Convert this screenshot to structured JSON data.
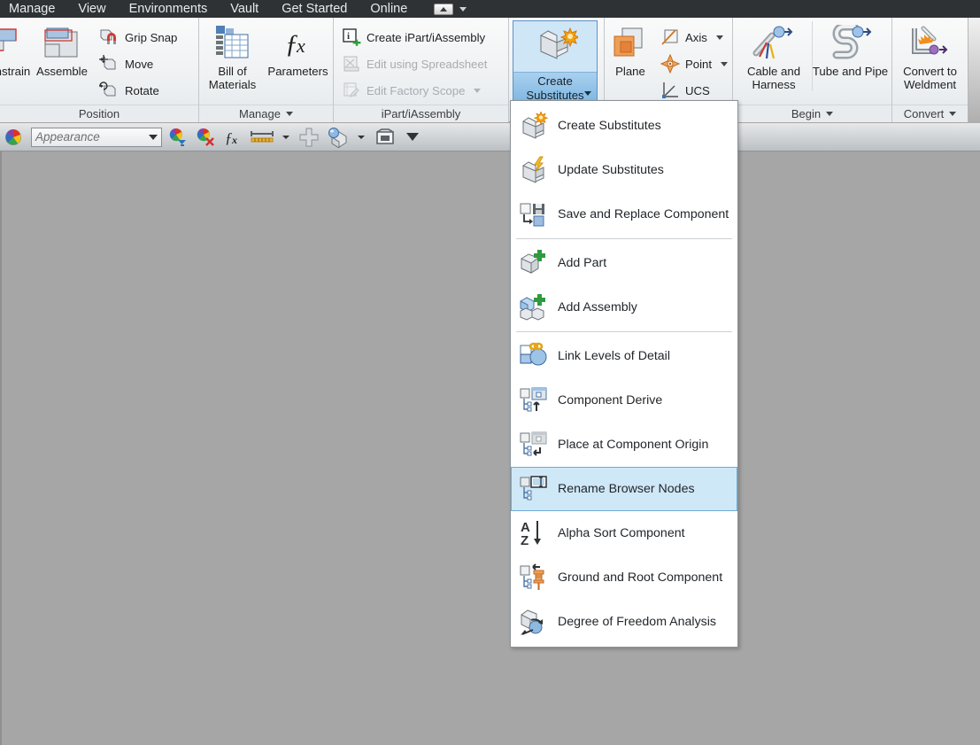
{
  "menubar": {
    "items": [
      "Manage",
      "View",
      "Environments",
      "Vault",
      "Get Started",
      "Online"
    ],
    "quick_access_icon": "minimize-ribbon-icon",
    "caret_icon": "chevron-down-icon"
  },
  "ribbon": {
    "panels": [
      {
        "title": "Position",
        "title_caret": false,
        "big_buttons": [
          {
            "label": "Constrain",
            "icon": "constrain-icon"
          },
          {
            "label": "Assemble",
            "icon": "assemble-icon"
          }
        ],
        "small_buttons": [
          {
            "label": "Grip Snap",
            "icon": "grip-snap-icon",
            "disabled": false,
            "caret": false
          },
          {
            "label": "Move",
            "icon": "move-component-icon",
            "disabled": false,
            "caret": false
          },
          {
            "label": "Rotate",
            "icon": "rotate-component-icon",
            "disabled": false,
            "caret": false
          }
        ]
      },
      {
        "title": "Manage",
        "title_caret": true,
        "big_buttons": [
          {
            "label": "Bill of Materials",
            "icon": "bill-of-materials-icon"
          },
          {
            "label": "Parameters",
            "icon": "parameters-fx-icon"
          }
        ],
        "small_buttons": []
      },
      {
        "title": "iPart/iAssembly",
        "title_caret": false,
        "big_buttons": [],
        "small_buttons": [
          {
            "label": "Create iPart/iAssembly",
            "icon": "create-ipart-icon",
            "disabled": false,
            "caret": false
          },
          {
            "label": "Edit using Spreadsheet",
            "icon": "edit-spreadsheet-icon",
            "disabled": true,
            "caret": false
          },
          {
            "label": "Edit Factory Scope",
            "icon": "edit-factory-scope-icon",
            "disabled": true,
            "caret": true
          }
        ]
      },
      {
        "title": "",
        "title_caret": false,
        "split_button": {
          "line1": "Create",
          "line2": "Substitutes",
          "icon": "create-substitutes-icon",
          "active": true,
          "caret_icon": "chevron-down-icon"
        }
      },
      {
        "title": "",
        "title_caret": false,
        "big_buttons": [
          {
            "label": "Plane",
            "icon": "work-plane-icon",
            "caret": true
          }
        ],
        "small_buttons": [
          {
            "label": "Axis",
            "icon": "work-axis-icon",
            "disabled": false,
            "caret": true
          },
          {
            "label": "Point",
            "icon": "work-point-icon",
            "disabled": false,
            "caret": true
          },
          {
            "label": "UCS",
            "icon": "ucs-icon",
            "disabled": false,
            "caret": false
          }
        ]
      },
      {
        "title": "Begin",
        "title_caret": true,
        "big_buttons": [
          {
            "label": "Cable and Harness",
            "icon": "cable-harness-icon"
          },
          {
            "label": "Tube and Pipe",
            "icon": "tube-pipe-icon"
          }
        ],
        "small_buttons": []
      },
      {
        "title": "Convert",
        "title_caret": true,
        "big_buttons": [
          {
            "label": "Convert to Weldment",
            "icon": "convert-weldment-icon"
          }
        ],
        "small_buttons": []
      }
    ]
  },
  "appearance_toolbar": {
    "swatch_icon": "color-wheel-icon",
    "select_value": "Appearance",
    "select_placeholder": "Appearance",
    "select_caret": "chevron-down-icon",
    "buttons": [
      {
        "icon": "adjust-appearance-icon"
      },
      {
        "icon": "clear-appearance-icon"
      },
      {
        "icon": "parameters-fx-icon"
      },
      {
        "icon": "measure-distance-icon",
        "caret": true
      },
      {
        "icon": "add-icon"
      },
      {
        "icon": "material-icon",
        "caret": true
      },
      {
        "icon": "view-icon"
      },
      {
        "icon": "more-options-icon"
      }
    ]
  },
  "dropdown": {
    "groups": [
      {
        "items": [
          {
            "label": "Create Substitutes",
            "icon": "create-substitutes-icon",
            "selected": false
          },
          {
            "label": "Update Substitutes",
            "icon": "update-substitutes-icon",
            "selected": false
          },
          {
            "label": "Save and Replace Component",
            "icon": "save-replace-component-icon",
            "selected": false
          }
        ]
      },
      {
        "items": [
          {
            "label": "Add Part",
            "icon": "add-part-icon",
            "selected": false
          },
          {
            "label": "Add Assembly",
            "icon": "add-assembly-icon",
            "selected": false
          }
        ]
      },
      {
        "items": [
          {
            "label": "Link Levels of Detail",
            "icon": "link-levels-of-detail-icon",
            "selected": false
          },
          {
            "label": "Component Derive",
            "icon": "component-derive-icon",
            "selected": false
          },
          {
            "label": "Place at Component Origin",
            "icon": "place-at-component-origin-icon",
            "selected": false
          },
          {
            "label": "Rename Browser Nodes",
            "icon": "rename-browser-nodes-icon",
            "selected": true
          },
          {
            "label": "Alpha Sort Component",
            "icon": "alpha-sort-component-icon",
            "selected": false
          },
          {
            "label": "Ground and Root Component",
            "icon": "ground-root-component-icon",
            "selected": false
          },
          {
            "label": "Degree of Freedom Analysis",
            "icon": "degree-of-freedom-analysis-icon",
            "selected": false
          }
        ]
      }
    ]
  },
  "colors": {
    "menubar_bg": "#2f3234",
    "ribbon_bg": "#eceff1",
    "canvas_bg": "#a6a6a6",
    "highlight_blue": "#cfe8f7",
    "highlight_border": "#6fa9d4",
    "accent_orange": "#e8820c"
  }
}
